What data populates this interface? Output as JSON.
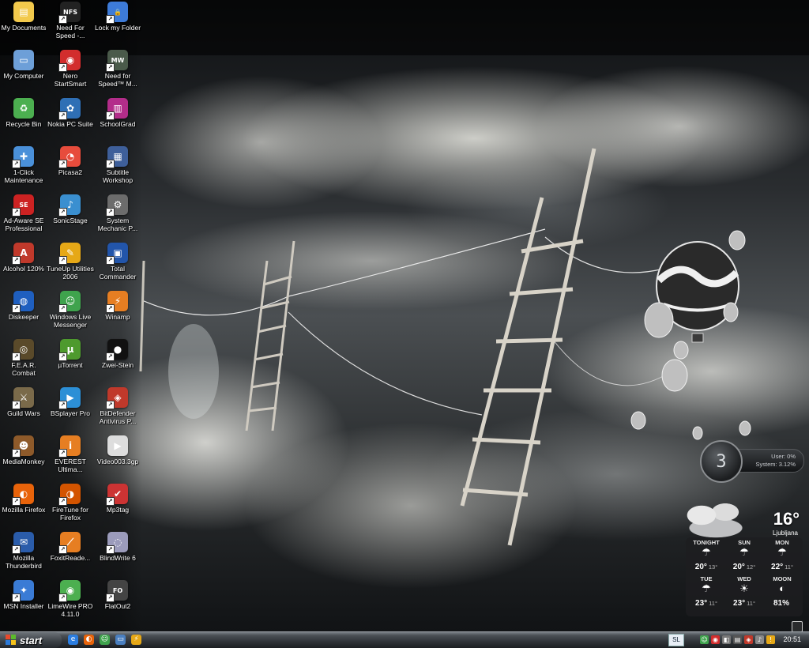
{
  "desktop": {
    "icons": [
      {
        "label": "My Documents",
        "icon": "folder-documents-icon",
        "color": "#f2c94c",
        "glyph": "▤",
        "shortcut": false
      },
      {
        "label": "Need For Speed -...",
        "icon": "nfs-game-icon",
        "color": "#222222",
        "glyph": "NFS",
        "shortcut": true
      },
      {
        "label": "Lock my Folder",
        "icon": "folder-lock-icon",
        "color": "#3d7bd8",
        "glyph": "🔒",
        "shortcut": true
      },
      {
        "label": "My Computer",
        "icon": "my-computer-icon",
        "color": "#6d9fd8",
        "glyph": "▭",
        "shortcut": false
      },
      {
        "label": "Nero StartSmart",
        "icon": "nero-icon",
        "color": "#d22d2d",
        "glyph": "◉",
        "shortcut": true
      },
      {
        "label": "Need for Speed™ M...",
        "icon": "nfs-mw-game-icon",
        "color": "#4a5a4a",
        "glyph": "MW",
        "shortcut": true
      },
      {
        "label": "Recycle Bin",
        "icon": "recycle-bin-icon",
        "color": "#4caf50",
        "glyph": "♻",
        "shortcut": false
      },
      {
        "label": "Nokia PC Suite",
        "icon": "nokia-suite-icon",
        "color": "#2f6fb5",
        "glyph": "✿",
        "shortcut": true
      },
      {
        "label": "SchoolGrad",
        "icon": "books-icon",
        "color": "#b32d8a",
        "glyph": "▥",
        "shortcut": true
      },
      {
        "label": "1-Click Maintenance",
        "icon": "maintenance-icon",
        "color": "#4a90d9",
        "glyph": "✚",
        "shortcut": true
      },
      {
        "label": "Picasa2",
        "icon": "picasa-icon",
        "color": "#e74c3c",
        "glyph": "◔",
        "shortcut": true
      },
      {
        "label": "Subtitle Workshop",
        "icon": "subtitle-workshop-icon",
        "color": "#3e5f9a",
        "glyph": "▦",
        "shortcut": true
      },
      {
        "label": "Ad-Aware SE Professional",
        "icon": "ad-aware-icon",
        "color": "#cc2222",
        "glyph": "SE",
        "shortcut": true
      },
      {
        "label": "SonicStage",
        "icon": "sonicstage-icon",
        "color": "#3a8fd0",
        "glyph": "♪",
        "shortcut": true
      },
      {
        "label": "System Mechanic P...",
        "icon": "system-mechanic-icon",
        "color": "#6c6c6c",
        "glyph": "⚙",
        "shortcut": true
      },
      {
        "label": "Alcohol 120%",
        "icon": "alcohol-icon",
        "color": "#c0392b",
        "glyph": "A",
        "shortcut": true
      },
      {
        "label": "TuneUp Utilities 2006",
        "icon": "tuneup-icon",
        "color": "#e6a817",
        "glyph": "✎",
        "shortcut": true
      },
      {
        "label": "Total Commander",
        "icon": "total-commander-icon",
        "color": "#2255aa",
        "glyph": "▣",
        "shortcut": true
      },
      {
        "label": "Diskeeper",
        "icon": "diskeeper-icon",
        "color": "#1f5fbf",
        "glyph": "◍",
        "shortcut": true
      },
      {
        "label": "Windows Live Messenger",
        "icon": "messenger-icon",
        "color": "#3fa34d",
        "glyph": "☺",
        "shortcut": true
      },
      {
        "label": "Winamp",
        "icon": "winamp-icon",
        "color": "#e67e22",
        "glyph": "⚡",
        "shortcut": true
      },
      {
        "label": "F.E.A.R. Combat",
        "icon": "fear-game-icon",
        "color": "#5a4a2a",
        "glyph": "◎",
        "shortcut": true
      },
      {
        "label": "µTorrent",
        "icon": "utorrent-icon",
        "color": "#4e9a2e",
        "glyph": "µ",
        "shortcut": true
      },
      {
        "label": "Zwei-Stein",
        "icon": "zwei-stein-icon",
        "color": "#111111",
        "glyph": "●",
        "shortcut": true
      },
      {
        "label": "Guild Wars",
        "icon": "guild-wars-icon",
        "color": "#7a6a4a",
        "glyph": "⚔",
        "shortcut": true
      },
      {
        "label": "BSplayer Pro",
        "icon": "bsplayer-icon",
        "color": "#2c8fd6",
        "glyph": "▶",
        "shortcut": true
      },
      {
        "label": "BitDefender Antivirus P...",
        "icon": "bitdefender-icon",
        "color": "#c0392b",
        "glyph": "◈",
        "shortcut": true
      },
      {
        "label": "MediaMonkey",
        "icon": "mediamonkey-icon",
        "color": "#8e5a2a",
        "glyph": "☻",
        "shortcut": true
      },
      {
        "label": "EVEREST Ultima...",
        "icon": "everest-icon",
        "color": "#e67e22",
        "glyph": "i",
        "shortcut": true
      },
      {
        "label": "Video003.3gp",
        "icon": "video-file-icon",
        "color": "#dddddd",
        "glyph": "▶",
        "shortcut": false
      },
      {
        "label": "Mozilla Firefox",
        "icon": "firefox-icon",
        "color": "#e8630a",
        "glyph": "◐",
        "shortcut": true
      },
      {
        "label": "FireTune for Firefox",
        "icon": "firetune-icon",
        "color": "#d35400",
        "glyph": "◑",
        "shortcut": true
      },
      {
        "label": "Mp3tag",
        "icon": "mp3tag-icon",
        "color": "#cc3333",
        "glyph": "✔",
        "shortcut": true
      },
      {
        "label": "Mozilla Thunderbird",
        "icon": "thunderbird-icon",
        "color": "#2a5caa",
        "glyph": "✉",
        "shortcut": true
      },
      {
        "label": "FoxitReade...",
        "icon": "foxit-reader-icon",
        "color": "#e67e22",
        "glyph": "⟋",
        "shortcut": true
      },
      {
        "label": "BlindWrite 6",
        "icon": "blindwrite-icon",
        "color": "#9b9bbb",
        "glyph": "◌",
        "shortcut": true
      },
      {
        "label": "MSN Installer",
        "icon": "msn-installer-icon",
        "color": "#3a7bd5",
        "glyph": "✦",
        "shortcut": true
      },
      {
        "label": "LimeWire PRO 4.11.0",
        "icon": "limewire-icon",
        "color": "#4caf50",
        "glyph": "◉",
        "shortcut": true
      },
      {
        "label": "FlatOut2",
        "icon": "flatout2-icon",
        "color": "#444444",
        "glyph": "FO",
        "shortcut": true
      }
    ]
  },
  "cpu_meter": {
    "dial_value": "3",
    "user": "User: 0%",
    "system": "System: 3.12%"
  },
  "weather": {
    "temperature": "16°",
    "city": "Ljubljana",
    "forecast": [
      {
        "day": "TONIGHT",
        "icon": "rain-cloud-icon",
        "glyph": "☂",
        "hi": "20°",
        "lo": "13°"
      },
      {
        "day": "SUN",
        "icon": "rain-cloud-icon",
        "glyph": "☂",
        "hi": "20°",
        "lo": "12°"
      },
      {
        "day": "MON",
        "icon": "rain-cloud-icon",
        "glyph": "☂",
        "hi": "22°",
        "lo": "11°"
      },
      {
        "day": "TUE",
        "icon": "rain-cloud-icon",
        "glyph": "☂",
        "hi": "23°",
        "lo": "11°"
      },
      {
        "day": "WED",
        "icon": "sun-cloud-icon",
        "glyph": "☀",
        "hi": "23°",
        "lo": "11°"
      },
      {
        "day": "MOON",
        "icon": "moon-phase-icon",
        "glyph": "◐",
        "hi": "81%",
        "lo": ""
      }
    ]
  },
  "taskbar": {
    "start_label": "start",
    "quick_launch": [
      {
        "icon": "internet-explorer-icon",
        "color": "#2b7de0",
        "glyph": "e"
      },
      {
        "icon": "firefox-icon",
        "color": "#e8630a",
        "glyph": "◐"
      },
      {
        "icon": "messenger-icon",
        "color": "#3fa34d",
        "glyph": "☺"
      },
      {
        "icon": "show-desktop-icon",
        "color": "#4a7fc0",
        "glyph": "▭"
      },
      {
        "icon": "winamp-icon",
        "color": "#e6a817",
        "glyph": "⚡"
      }
    ],
    "language": "SL",
    "tray": [
      {
        "icon": "messenger-tray-icon",
        "color": "#3fa34d",
        "glyph": "☺"
      },
      {
        "icon": "nero-tray-icon",
        "color": "#d22d2d",
        "glyph": "◉"
      },
      {
        "icon": "security-tray-icon",
        "color": "#777777",
        "glyph": "◧"
      },
      {
        "icon": "network-tray-icon",
        "color": "#555555",
        "glyph": "▤"
      },
      {
        "icon": "bitdefender-tray-icon",
        "color": "#c0392b",
        "glyph": "◈"
      },
      {
        "icon": "volume-tray-icon",
        "color": "#888888",
        "glyph": "♪"
      },
      {
        "icon": "updates-tray-icon",
        "color": "#e6a817",
        "glyph": "!"
      }
    ],
    "clock": "20:51"
  }
}
